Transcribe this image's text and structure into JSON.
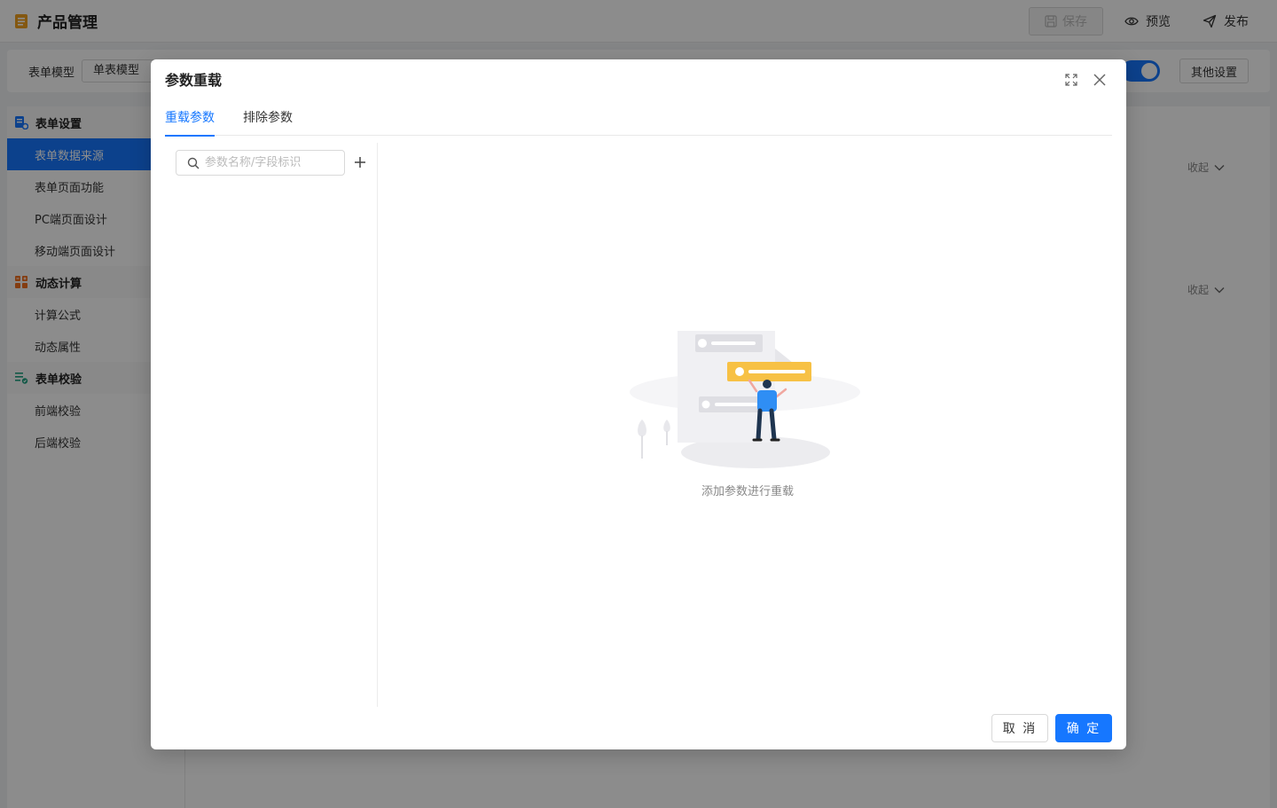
{
  "app": {
    "title": "产品管理",
    "save_label": "保存",
    "preview_label": "预览",
    "publish_label": "发布"
  },
  "toolbar": {
    "form_model_label": "表单模型",
    "form_model_value": "单表模型",
    "other_settings_label": "其他设置"
  },
  "sidebar": {
    "groups": [
      {
        "title": "表单设置",
        "items": [
          "表单数据来源",
          "表单页面功能",
          "PC端页面设计",
          "移动端页面设计"
        ]
      },
      {
        "title": "动态计算",
        "items": [
          "计算公式",
          "动态属性"
        ]
      },
      {
        "title": "表单校验",
        "items": [
          "前端校验",
          "后端校验"
        ]
      }
    ],
    "active_item": "表单数据来源"
  },
  "main": {
    "collapse_label": "收起"
  },
  "modal": {
    "title": "参数重载",
    "tabs": [
      {
        "label": "重载参数",
        "active": true
      },
      {
        "label": "排除参数",
        "active": false
      }
    ],
    "search": {
      "placeholder": "参数名称/字段标识",
      "value": ""
    },
    "empty_text": "添加参数进行重载",
    "cancel_label": "取 消",
    "ok_label": "确 定"
  },
  "colors": {
    "primary": "#1677ff",
    "illustration_yellow": "#f7c145",
    "illustration_gray": "#e6e6e9"
  }
}
